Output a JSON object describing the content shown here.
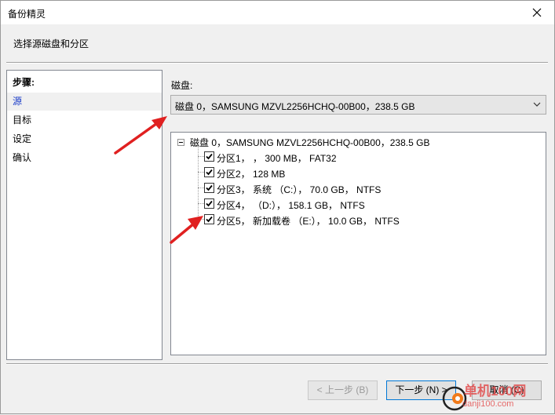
{
  "window": {
    "title": "备份精灵",
    "subtitle": "选择源磁盘和分区"
  },
  "steps": {
    "header": "步骤:",
    "items": [
      "源",
      "目标",
      "设定",
      "确认"
    ],
    "active_index": 0
  },
  "disk": {
    "label": "磁盘:",
    "selected": "磁盘 0，SAMSUNG MZVL2256HCHQ-00B00，238.5 GB"
  },
  "tree": {
    "root": "磁盘 0，SAMSUNG MZVL2256HCHQ-00B00，238.5 GB",
    "partitions": [
      {
        "label": "分区1，  ，  300 MB， FAT32",
        "checked": true
      },
      {
        "label": "分区2， 128 MB",
        "checked": true
      },
      {
        "label": "分区3， 系统 （C:）， 70.0 GB， NTFS",
        "checked": true
      },
      {
        "label": "分区4，    （D:）， 158.1 GB， NTFS",
        "checked": true
      },
      {
        "label": "分区5， 新加载卷 （E:）， 10.0 GB， NTFS",
        "checked": true
      }
    ]
  },
  "buttons": {
    "back": "< 上一步 (B)",
    "next": "下一步 (N) >",
    "cancel": "取消 (C)"
  },
  "watermark": {
    "line1": "单机100网",
    "line2": "danji100.com"
  },
  "colors": {
    "accent_blue": "#1a3cc8",
    "arrow_red": "#e02020",
    "button_focus_border": "#0078d7"
  }
}
